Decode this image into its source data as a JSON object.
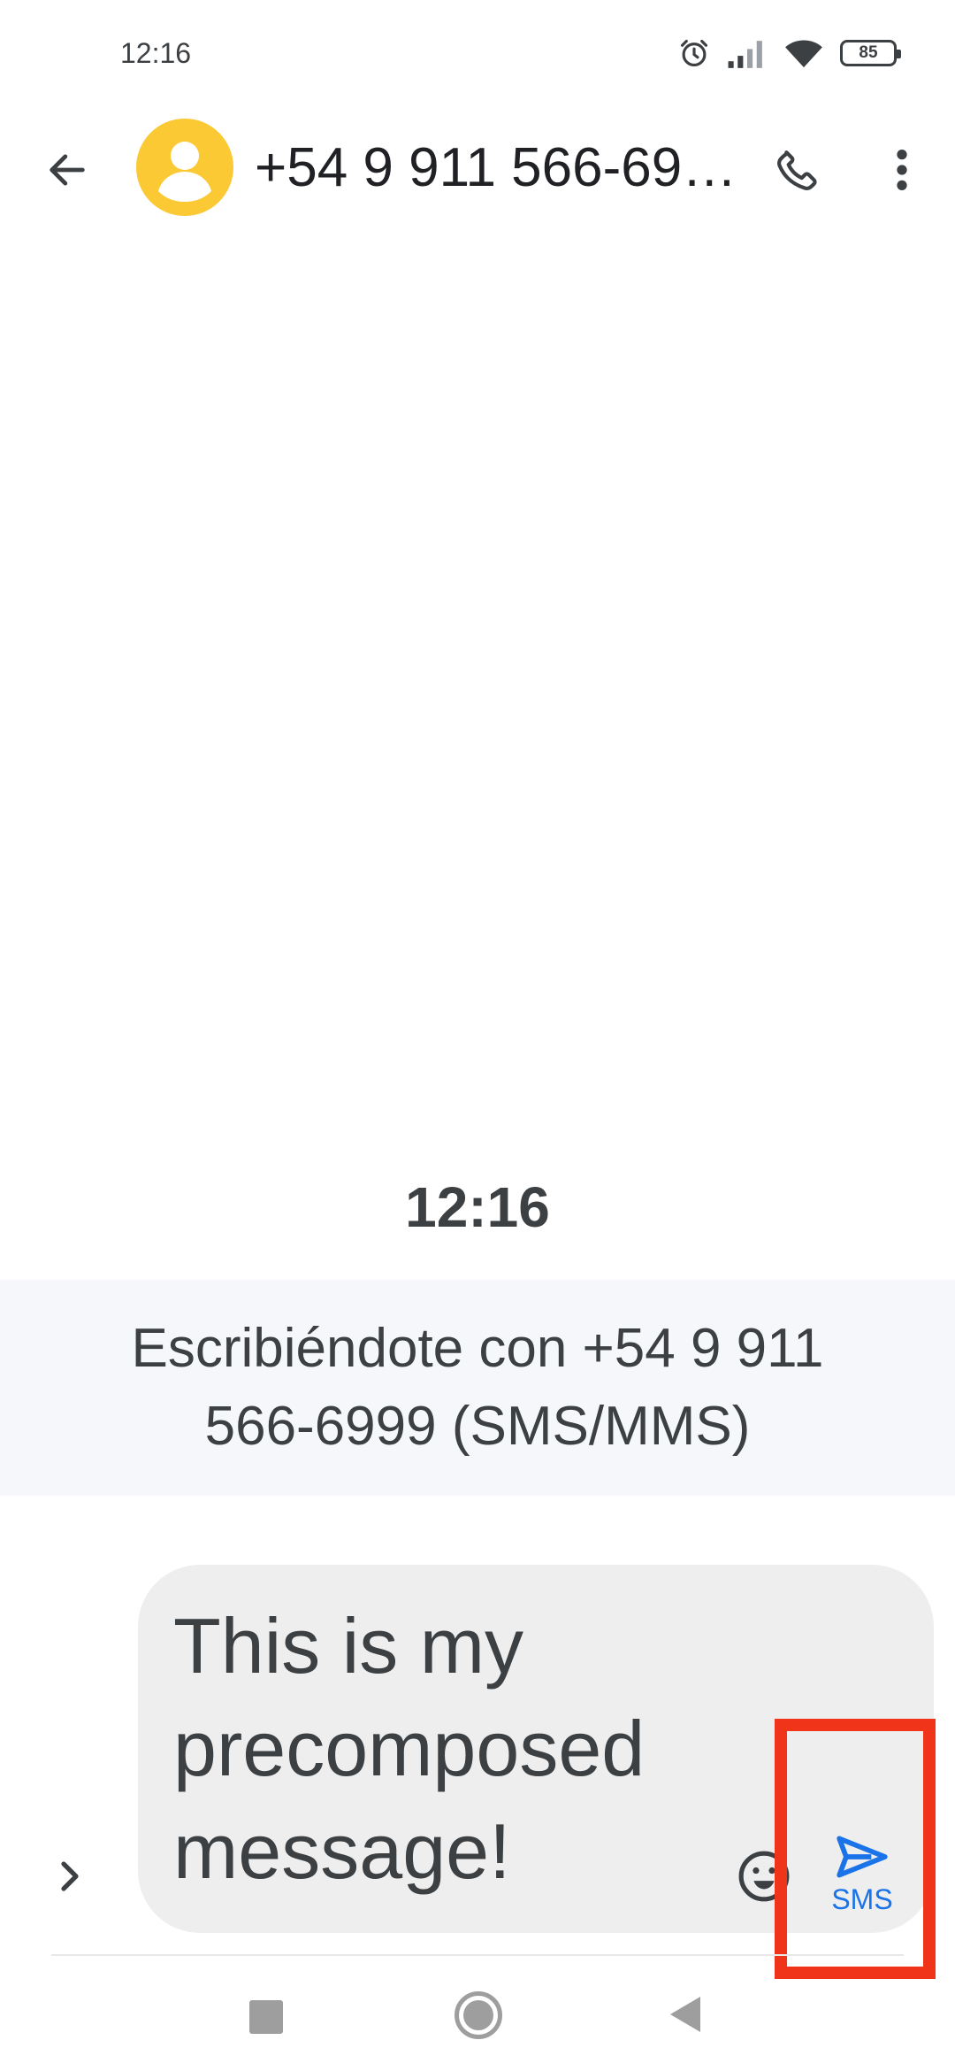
{
  "status_bar": {
    "time": "12:16",
    "battery_level": "85",
    "icons": [
      "alarm-icon",
      "signal-icon",
      "wifi-icon",
      "battery-icon"
    ]
  },
  "app_bar": {
    "contact_name": "+54 9 911 566-69…",
    "icons": [
      "back-arrow-icon",
      "person-icon",
      "phone-icon",
      "more-vert-icon"
    ]
  },
  "conversation": {
    "timestamp": "12:16",
    "sim_banner": "Escribiéndote con +54 9 911 566-6999 (SMS/MMS)"
  },
  "compose": {
    "message_text": "This is my precomposed message!",
    "send_label": "SMS",
    "icons": [
      "chevron-right-icon",
      "emoji-icon",
      "send-icon"
    ]
  },
  "colors": {
    "avatar": "#fbc934",
    "accent": "#1a73e8",
    "highlight": "#f03419",
    "banner_bg": "#f6f7fb",
    "compose_bg": "#eeeeee"
  }
}
